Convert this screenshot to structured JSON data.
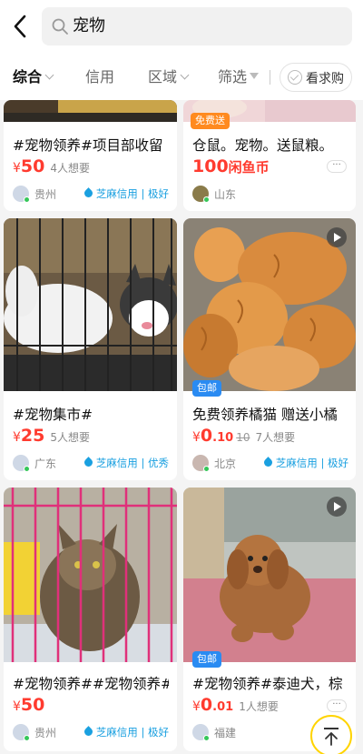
{
  "search": {
    "query": "宠物"
  },
  "filters": [
    {
      "label": "综合",
      "active": true
    },
    {
      "label": "信用"
    },
    {
      "label": "区域"
    },
    {
      "label": "筛选"
    }
  ],
  "want_buy_label": "看求购",
  "cards": [
    {
      "title": "#宠物领养#项目部收留",
      "currency": "¥",
      "price": "50",
      "want": "4人想要",
      "location": "贵州",
      "credit": "芝麻信用 | 极好"
    },
    {
      "badge": "免费送",
      "title": "仓鼠。宠物。送鼠粮。",
      "price": "100",
      "price_unit": "闲鱼币",
      "location": "山东",
      "more": "···"
    },
    {
      "title": "#宠物集市#",
      "currency": "¥",
      "price": "25",
      "want": "5人想要",
      "location": "广东",
      "credit": "芝麻信用 | 优秀"
    },
    {
      "badge": "包邮",
      "title": "免费领养橘猫 赠送小橘",
      "currency": "¥",
      "price_int": "0",
      "price_dec": ".10",
      "original": "10",
      "want": "7人想要",
      "location": "北京",
      "credit": "芝麻信用 | 极好"
    },
    {
      "title": "#宠物领养##宠物领养#",
      "currency": "¥",
      "price": "50",
      "location": "贵州",
      "credit": "芝麻信用 | 极好"
    },
    {
      "badge": "包邮",
      "title": "#宠物领养#泰迪犬，棕",
      "currency": "¥",
      "price_int": "0",
      "price_dec": ".01",
      "want": "1人想要",
      "location": "福建",
      "more": "···"
    }
  ],
  "colors": {
    "accent": "#ff3b2f",
    "credit": "#1aa0e0",
    "badge_orange": "#ff8a1f",
    "badge_blue": "#2a8bf2",
    "top_button_ring": "#ffd400"
  },
  "icons": [
    "back-arrow-icon",
    "search-icon",
    "chevron-down-icon",
    "filter-icon",
    "check-circle-icon",
    "sesame-credit-icon",
    "play-icon",
    "back-to-top-icon"
  ]
}
